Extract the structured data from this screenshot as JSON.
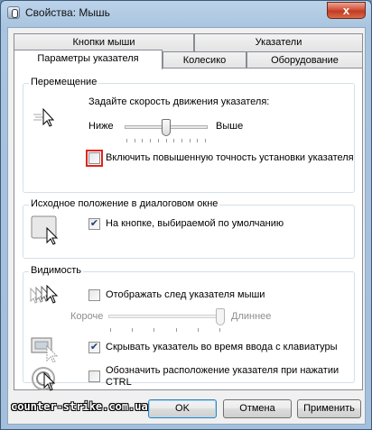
{
  "window": {
    "title": "Свойства: Мышь",
    "close_glyph": "x"
  },
  "tabs": {
    "back_row": [
      {
        "label": "Кнопки мыши"
      },
      {
        "label": "Указатели"
      }
    ],
    "front_row": [
      {
        "label": "Параметры указателя",
        "active": true
      },
      {
        "label": "Колесико"
      },
      {
        "label": "Оборудование"
      }
    ]
  },
  "motion": {
    "group_title": "Перемещение",
    "speed_label": "Задайте скорость движения указателя:",
    "slow_label": "Ниже",
    "fast_label": "Выше",
    "speed_value_fraction": 0.5,
    "precision_label": "Включить повышенную точность установки указателя",
    "precision_checked": false,
    "icon": "pointer-speed-icon"
  },
  "snap_to": {
    "group_title": "Исходное положение в диалоговом окне",
    "default_button_label": "На кнопке, выбираемой по умолчанию",
    "default_button_checked": true,
    "icon": "snap-to-button-icon"
  },
  "visibility": {
    "group_title": "Видимость",
    "trails_label": "Отображать след указателя мыши",
    "trails_checked": false,
    "short_label": "Короче",
    "long_label": "Длиннее",
    "trails_value_fraction": 1.0,
    "hide_label": "Скрывать указатель во время ввода с клавиатуры",
    "hide_checked": true,
    "ctrl_label_line1": "Обозначить расположение указателя при нажатии",
    "ctrl_label_line2": "CTRL",
    "ctrl_checked": false
  },
  "buttons": {
    "ok": "OK",
    "cancel": "Отмена",
    "apply": "Применить"
  },
  "watermark": "counter-strike.com.ua",
  "check_glyph": "✔"
}
